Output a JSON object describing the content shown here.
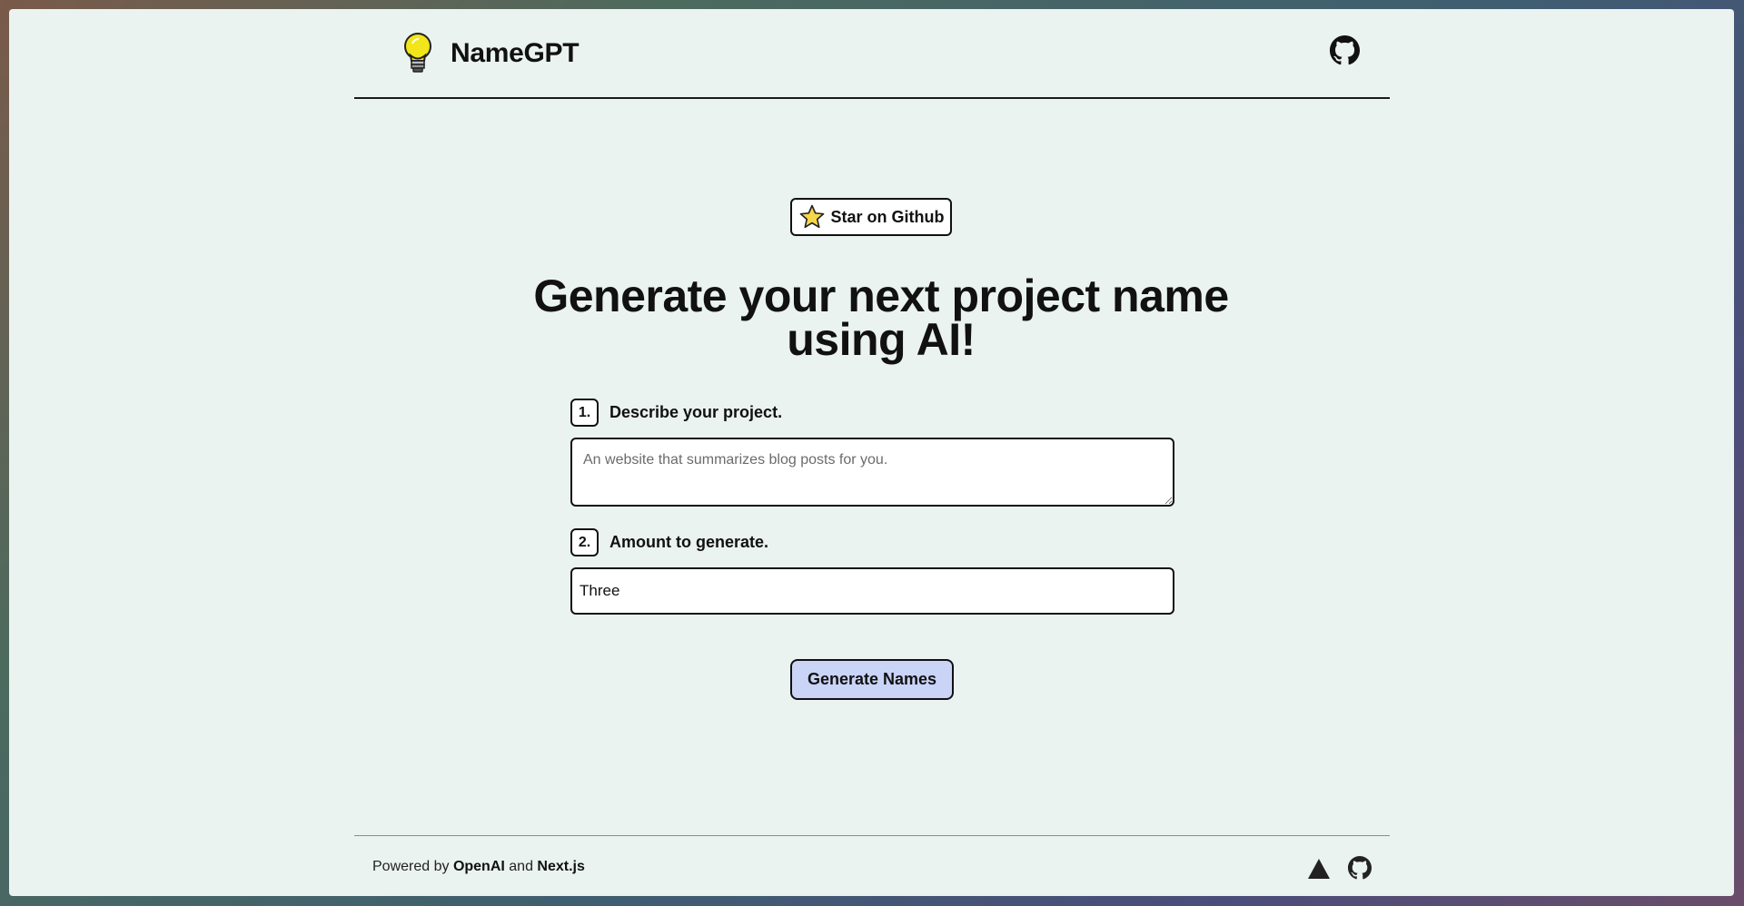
{
  "header": {
    "brand": "NameGPT",
    "icons": {
      "logo": "lightbulb-icon",
      "repo": "github-icon"
    }
  },
  "hero": {
    "star_button_label": "Star on Github",
    "headline": "Generate your next project name using AI!"
  },
  "form": {
    "step1": {
      "number": "1.",
      "label": "Describe your project."
    },
    "description": {
      "value": "",
      "placeholder": "An website that summarizes blog posts for you."
    },
    "step2": {
      "number": "2.",
      "label": "Amount to generate."
    },
    "amount": {
      "selected": "Three"
    },
    "generate_label": "Generate Names"
  },
  "footer": {
    "prefix": "Powered by ",
    "openai": "OpenAI",
    "and": " and ",
    "nextjs": "Next.js",
    "icons": [
      "vercel-triangle-icon",
      "github-icon"
    ]
  },
  "colors": {
    "page_bg": "#eaf3ef",
    "button_primary": "#c9d4f7",
    "border": "#111111"
  }
}
